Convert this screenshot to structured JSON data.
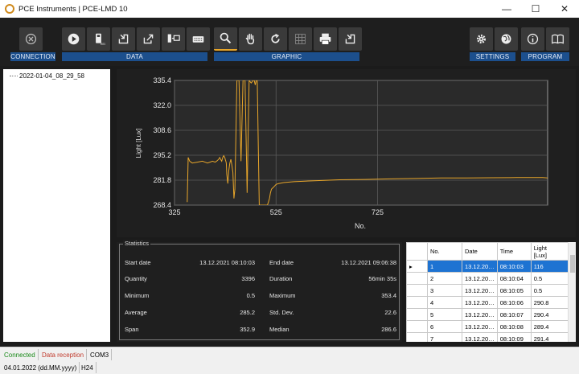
{
  "window": {
    "title": "PCE Instruments | PCE-LMD 10",
    "minimize": "—",
    "maximize": "☐",
    "close": "✕"
  },
  "groups": {
    "connection": "CONNECTION",
    "data": "DATA",
    "graphic": "GRAPHIC",
    "settings": "SETTINGS",
    "program": "PROGRAM"
  },
  "tree": {
    "node": "2022-01-04_08_29_58"
  },
  "chart_data": {
    "type": "line",
    "title": "",
    "xlabel": "No.",
    "ylabel": "Light [Lux]",
    "xlim": [
      325,
      1060
    ],
    "ylim": [
      268.4,
      335.4
    ],
    "yticks": [
      "335.4",
      "322.0",
      "308.6",
      "295.2",
      "281.8",
      "268.4"
    ],
    "xticks": [
      "325",
      "525",
      "725"
    ],
    "grid": true,
    "color": "#e8a62a",
    "series": [
      {
        "x": [
          350,
          352,
          355,
          360,
          370,
          380,
          390,
          400,
          405,
          408,
          412,
          414,
          416,
          418,
          420,
          422,
          424,
          425,
          426,
          427,
          428,
          430,
          432,
          434,
          436,
          438,
          440,
          442,
          444,
          448,
          452,
          456,
          460,
          464,
          468,
          472,
          476,
          480,
          482,
          484,
          486,
          488,
          490,
          492,
          494,
          496,
          498,
          500,
          502,
          504,
          506,
          508,
          510,
          512,
          514,
          516,
          520,
          525,
          530,
          540,
          560,
          600,
          650,
          700,
          750,
          800,
          850,
          900,
          950,
          1000,
          1050,
          1060
        ],
        "values": [
          270,
          294,
          292,
          291,
          291.5,
          292,
          291,
          292,
          291.5,
          292,
          293,
          294,
          293,
          292,
          294,
          295,
          294,
          293,
          292,
          291,
          285,
          280,
          287,
          291,
          293,
          290,
          286,
          272,
          277,
          335.4,
          335.4,
          292,
          335.4,
          335.4,
          275,
          335.4,
          334,
          335.4,
          335.4,
          333,
          335.4,
          335.4,
          300,
          268.4,
          268.4,
          268.4,
          268.4,
          268.4,
          268.4,
          268.4,
          268.4,
          268.4,
          270,
          272,
          275,
          277,
          278,
          279.5,
          280,
          280.5,
          281,
          281.5,
          282,
          282.2,
          282.5,
          282.7,
          283,
          283,
          283.1,
          283.2,
          283.2,
          283
        ]
      }
    ]
  },
  "stats": {
    "legend": "Statistics",
    "rows": [
      {
        "l1": "Start date",
        "v1": "13.12.2021 08:10:03",
        "l2": "End date",
        "v2": "13.12.2021 09:06:38"
      },
      {
        "l1": "Quantity",
        "v1": "3396",
        "l2": "Duration",
        "v2": "56min 35s"
      },
      {
        "l1": "Minimum",
        "v1": "0.5",
        "l2": "Maximum",
        "v2": "353.4"
      },
      {
        "l1": "Average",
        "v1": "285.2",
        "l2": "Std. Dev.",
        "v2": "22.6"
      },
      {
        "l1": "Span",
        "v1": "352.9",
        "l2": "Median",
        "v2": "286.6"
      }
    ]
  },
  "table": {
    "headers": [
      "No.",
      "Date",
      "Time",
      "Light\n[Lux]"
    ],
    "rows": [
      [
        "1",
        "13.12.20…",
        "08:10:03",
        "116"
      ],
      [
        "2",
        "13.12.20…",
        "08:10:04",
        "0.5"
      ],
      [
        "3",
        "13.12.20…",
        "08:10:05",
        "0.5"
      ],
      [
        "4",
        "13.12.20…",
        "08:10:06",
        "290.8"
      ],
      [
        "5",
        "13.12.20…",
        "08:10:07",
        "290.4"
      ],
      [
        "6",
        "13.12.20…",
        "08:10:08",
        "289.4"
      ],
      [
        "7",
        "13.12.20…",
        "08:10:09",
        "291.4"
      ]
    ]
  },
  "status": {
    "connected": "Connected",
    "reception": "Data reception",
    "port": "COM3",
    "date_fmt": "04.01.2022 (dd.MM.yyyy)",
    "time_fmt": "H24"
  },
  "colors": {
    "connected": "#1a8a1a",
    "reception": "#c0392b",
    "accent": "#e8a62a",
    "group": "#1c4f8d"
  }
}
